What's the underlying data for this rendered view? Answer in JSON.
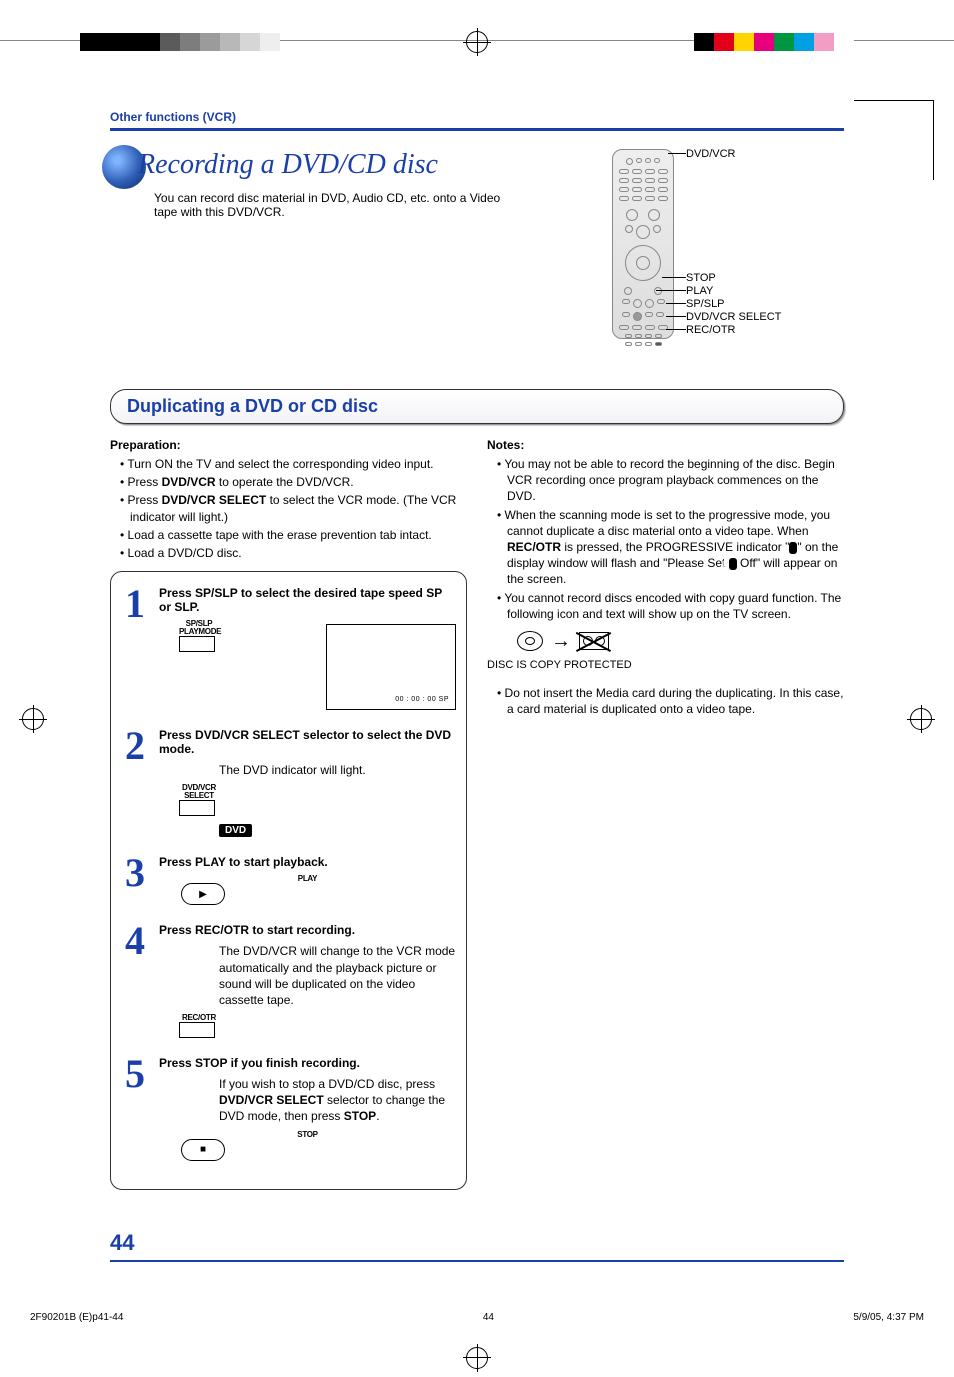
{
  "header": "Other functions (VCR)",
  "title": "Recording a DVD/CD disc",
  "subtitle": "You can record disc material in DVD, Audio CD, etc. onto a Video tape with this DVD/VCR.",
  "remote_labels": {
    "top": "DVD/VCR",
    "l1": "STOP",
    "l2": "PLAY",
    "l3": "SP/SLP",
    "l4": "DVD/VCR SELECT",
    "l5": "REC/OTR"
  },
  "section_title": "Duplicating a DVD or CD disc",
  "prep": {
    "heading": "Preparation:",
    "items": [
      "Turn ON the TV and select the corresponding video input.",
      "Press <b>DVD/VCR</b> to operate the DVD/VCR.",
      "Press <b>DVD/VCR SELECT</b> to select the VCR mode. (The VCR indicator will light.)",
      "Load a cassette tape with the erase prevention tab intact.",
      "Load a DVD/CD disc."
    ]
  },
  "steps": [
    {
      "num": "1",
      "title": "Press SP/SLP to select the desired tape speed SP or SLP.",
      "btn_top": "SP/SLP",
      "btn_bot": "PLAYMODE",
      "display_text": "00 : 00 : 00   SP",
      "desc": ""
    },
    {
      "num": "2",
      "title": "Press DVD/VCR SELECT selector to select the DVD mode.",
      "btn_top": "DVD/VCR",
      "btn_bot": "SELECT",
      "badge": "DVD",
      "desc": "The DVD indicator will light."
    },
    {
      "num": "3",
      "title": "Press PLAY to start playback.",
      "btn_top": "PLAY",
      "oval": true,
      "desc": ""
    },
    {
      "num": "4",
      "title": "Press REC/OTR to start recording.",
      "btn_top": "REC/OTR",
      "desc": "The DVD/VCR will change to the VCR mode automatically and the playback picture or sound will be duplicated on the video cassette tape."
    },
    {
      "num": "5",
      "title": "Press STOP if you finish recording.",
      "btn_top": "STOP",
      "oval": true,
      "oval_glyph": "■",
      "desc_html": "If you wish to stop a DVD/CD disc, press <b>DVD/VCR SELECT</b> selector to change the DVD mode, then press <b>STOP</b>."
    }
  ],
  "notes": {
    "heading": "Notes:",
    "items": [
      "You may not be able to record the beginning of the disc. Begin VCR recording once program playback commences on the DVD.",
      "When the scanning mode is set to the progressive mode, you cannot duplicate a disc material onto a video tape. When <b>REC/OTR</b> is pressed, the PROGRESSIVE indicator \"<span class='p-icon'>P</span>\" on the display window will flash and \"Please Set <span class='p-icon'>P</span> Off\" will appear on the screen.",
      "You cannot record discs encoded with copy guard function. The following icon and text will show up on the TV screen."
    ],
    "copy_caption": "DISC IS COPY PROTECTED",
    "trailing": [
      "Do not insert the Media card during the duplicating. In this case, a card material is duplicated onto a video tape."
    ]
  },
  "page_number": "44",
  "foot": {
    "left": "2F90201B (E)p41-44",
    "mid": "44",
    "right": "5/9/05, 4:37 PM"
  }
}
